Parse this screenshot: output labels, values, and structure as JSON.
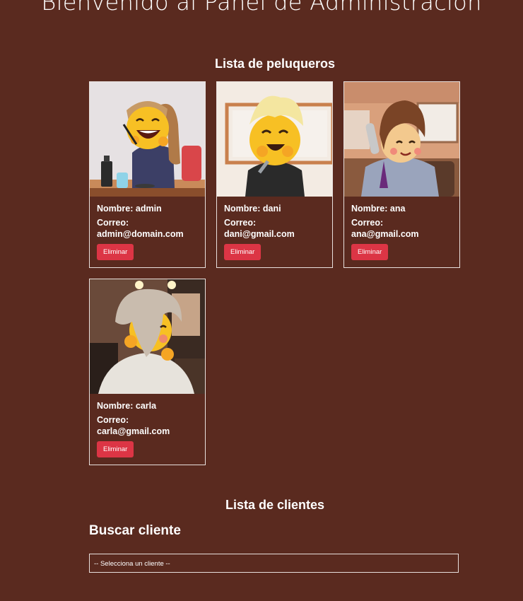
{
  "header": {
    "title": "Bienvenido al Panel de Administración"
  },
  "peluqueros": {
    "title": "Lista de peluqueros",
    "items": [
      {
        "nombre": "Nombre: admin",
        "correo": "Correo: admin@domain.com",
        "button": "Eliminar"
      },
      {
        "nombre": "Nombre: dani",
        "correo": "Correo: dani@gmail.com",
        "button": "Eliminar"
      },
      {
        "nombre": "Nombre: ana",
        "correo": "Correo: ana@gmail.com",
        "button": "Eliminar"
      },
      {
        "nombre": "Nombre: carla",
        "correo": "Correo: carla@gmail.com",
        "button": "Eliminar"
      }
    ]
  },
  "clientes": {
    "title": "Lista de clientes",
    "search_title": "Buscar cliente",
    "select_value": "-- Selecciona un cliente --"
  },
  "colors": {
    "background": "#5a2a1f",
    "danger": "#dc3545",
    "border": "#e8e0dd"
  }
}
